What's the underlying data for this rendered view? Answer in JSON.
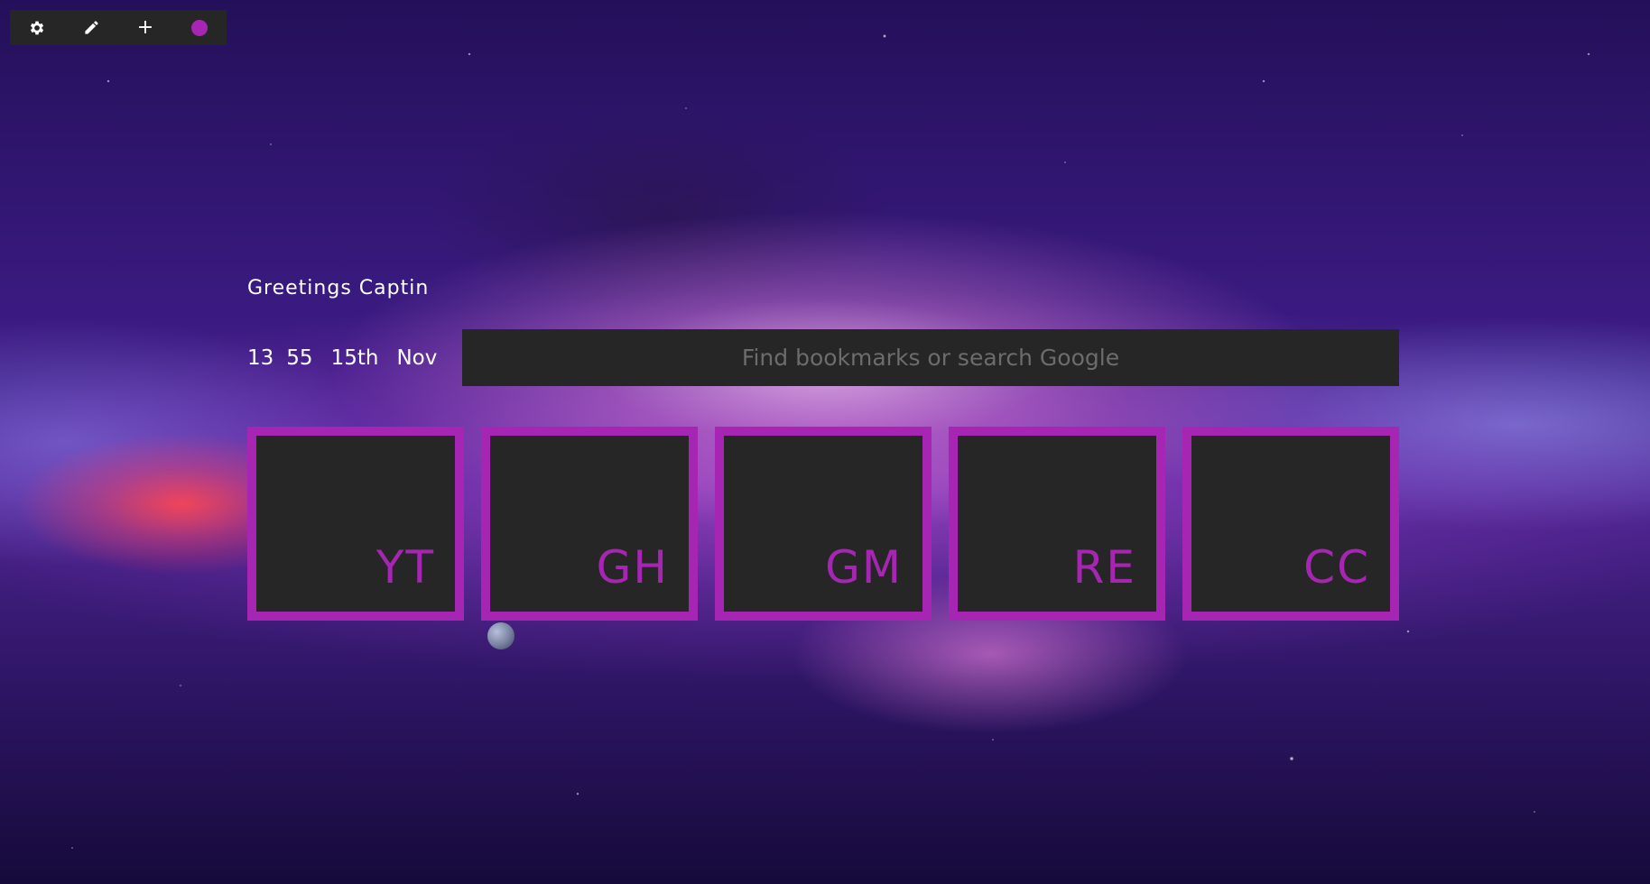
{
  "colors": {
    "accent": "#a626b3",
    "panel": "#262626",
    "text": "#ffffff",
    "placeholder": "#6c6c6c"
  },
  "toolbar": {
    "items": [
      {
        "icon": "gear-icon"
      },
      {
        "icon": "pencil-icon"
      },
      {
        "icon": "plus-icon",
        "glyph": "+"
      },
      {
        "icon": "color-dot-icon",
        "color": "#a626b3"
      }
    ]
  },
  "greeting": "Greetings Captin",
  "clock": {
    "hours": "13",
    "minutes": "55",
    "day": "15th",
    "month": "Nov"
  },
  "search": {
    "placeholder": "Find bookmarks or search Google",
    "value": ""
  },
  "bookmarks": [
    {
      "label": "YT"
    },
    {
      "label": "GH"
    },
    {
      "label": "GM"
    },
    {
      "label": "RE"
    },
    {
      "label": "CC"
    }
  ]
}
